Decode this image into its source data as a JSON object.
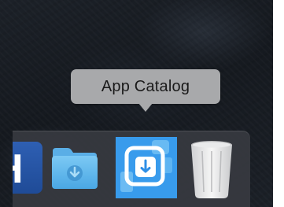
{
  "tooltip": {
    "label": "App Catalog"
  },
  "dock": {
    "items": [
      {
        "name": "partial-app",
        "icon": "letter-h-app-icon",
        "glyph": "H",
        "color": "#2e5fb3"
      },
      {
        "name": "downloads",
        "icon": "downloads-folder-icon",
        "color": "#5cb8ee"
      },
      {
        "name": "app-catalog",
        "icon": "app-catalog-icon",
        "selected": true,
        "color": "#3fa4f0"
      },
      {
        "name": "trash",
        "icon": "trash-icon",
        "color": "#e8e8e8"
      }
    ]
  }
}
